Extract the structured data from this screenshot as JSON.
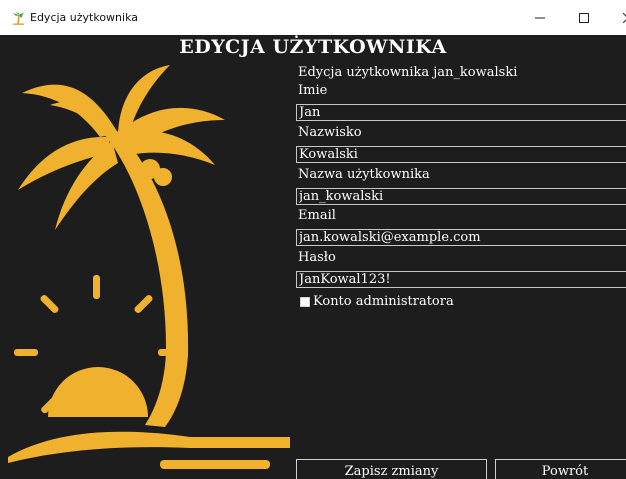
{
  "window": {
    "title": "Edycja użytkownika",
    "icon": "palm-tree-icon",
    "controls": [
      "minimize-icon",
      "maximize-icon",
      "close-icon"
    ]
  },
  "colors": {
    "background": "#1d1d1d",
    "accent": "#f0b22e",
    "text": "#ffffff"
  },
  "heading": "EDYCJA UŻYTKOWNIKA",
  "subtitle": "Edycja użytkownika jan_kowalski",
  "form": {
    "first_name": {
      "label": "Imie",
      "value": "Jan"
    },
    "last_name": {
      "label": "Nazwisko",
      "value": "Kowalski"
    },
    "username": {
      "label": "Nazwa użytkownika",
      "value": "jan_kowalski"
    },
    "email": {
      "label": "Email",
      "value": "jan.kowalski@example.com"
    },
    "password": {
      "label": "Hasło",
      "value": "JanKowal123!"
    },
    "admin": {
      "label": "Konto administratora",
      "checked": false
    }
  },
  "buttons": {
    "save": "Zapisz zmiany",
    "back": "Powrót"
  },
  "logo": "palm-tree-sunset-logo"
}
